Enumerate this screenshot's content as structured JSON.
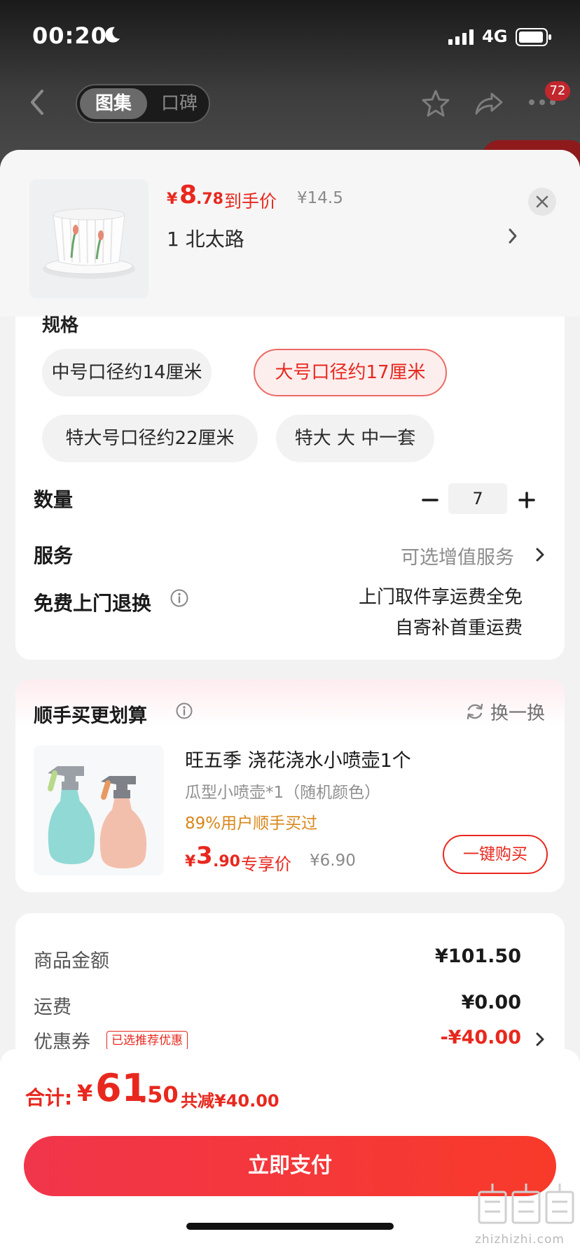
{
  "status": {
    "time": "00:20",
    "network": "4G"
  },
  "nav": {
    "tabs": [
      {
        "label": "图集",
        "active": true
      },
      {
        "label": "口碑",
        "active": false
      }
    ],
    "badge_count": "72"
  },
  "product": {
    "price_symbol": "¥",
    "price_int": "8",
    "price_dec": ".78",
    "price_tag": "到手价",
    "original_price": "¥14.5",
    "address": "1  北太路"
  },
  "spec": {
    "label": "规格",
    "options": [
      {
        "label": "中号口径约14厘米",
        "selected": false
      },
      {
        "label": "大号口径约17厘米",
        "selected": true
      },
      {
        "label": "特大号口径约22厘米",
        "selected": false
      },
      {
        "label": "特大 大 中一套",
        "selected": false
      }
    ]
  },
  "quantity": {
    "label": "数量",
    "value": "7"
  },
  "service": {
    "label": "服务",
    "value": "可选增值服务"
  },
  "return_policy": {
    "label": "免费上门退换",
    "line1": "上门取件享运费全免",
    "line2": "自寄补首重运费"
  },
  "upsell": {
    "title": "顺手买更划算",
    "refresh_label": "换一换",
    "name": "旺五季 浇花浇水小喷壶1个",
    "spec": "瓜型小喷壶*1（随机颜色）",
    "social": "89%用户顺手买过",
    "price_symbol": "¥",
    "price_int": "3",
    "price_dec": ".90",
    "price_tag": "专享价",
    "original_price": "¥6.90",
    "buy_label": "一键购买"
  },
  "summary": {
    "goods_label": "商品金额",
    "goods_value": "¥101.50",
    "shipping_label": "运费",
    "shipping_value": "¥0.00",
    "coupon_label": "优惠券",
    "coupon_tag": "已选推荐优惠",
    "coupon_value": "-¥40.00"
  },
  "footer": {
    "total_label": "合计:",
    "total_symbol": "¥",
    "total_int": "61",
    "total_dec": ".50",
    "saved": "共减¥40.00",
    "pay_label": "立即支付",
    "watermark": "zhizhizhi.com"
  },
  "colors": {
    "accent": "#e8281e",
    "orange": "#d9861a"
  }
}
